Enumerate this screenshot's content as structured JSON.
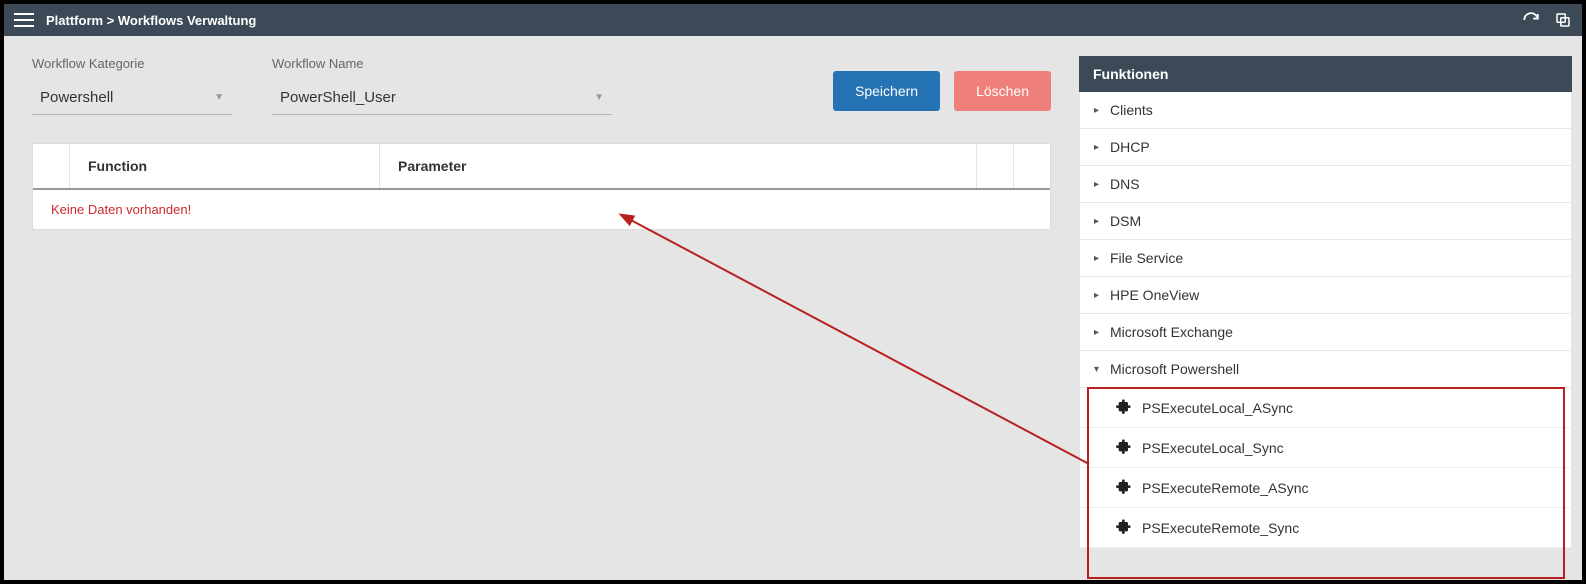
{
  "breadcrumb": "Plattform > Workflows Verwaltung",
  "form": {
    "category_label": "Workflow Kategorie",
    "category_value": "Powershell",
    "name_label": "Workflow Name",
    "name_value": "PowerShell_User",
    "save_label": "Speichern",
    "delete_label": "Löschen"
  },
  "table": {
    "col_function": "Function",
    "col_parameter": "Parameter",
    "empty_msg": "Keine Daten vorhanden!"
  },
  "panel": {
    "title": "Funktionen",
    "nodes": [
      {
        "label": "Clients",
        "expanded": false
      },
      {
        "label": "DHCP",
        "expanded": false
      },
      {
        "label": "DNS",
        "expanded": false
      },
      {
        "label": "DSM",
        "expanded": false
      },
      {
        "label": "File Service",
        "expanded": false
      },
      {
        "label": "HPE OneView",
        "expanded": false
      },
      {
        "label": "Microsoft Exchange",
        "expanded": false
      },
      {
        "label": "Microsoft Powershell",
        "expanded": true,
        "children": [
          "PSExecuteLocal_ASync",
          "PSExecuteLocal_Sync",
          "PSExecuteRemote_ASync",
          "PSExecuteRemote_Sync"
        ]
      }
    ]
  }
}
